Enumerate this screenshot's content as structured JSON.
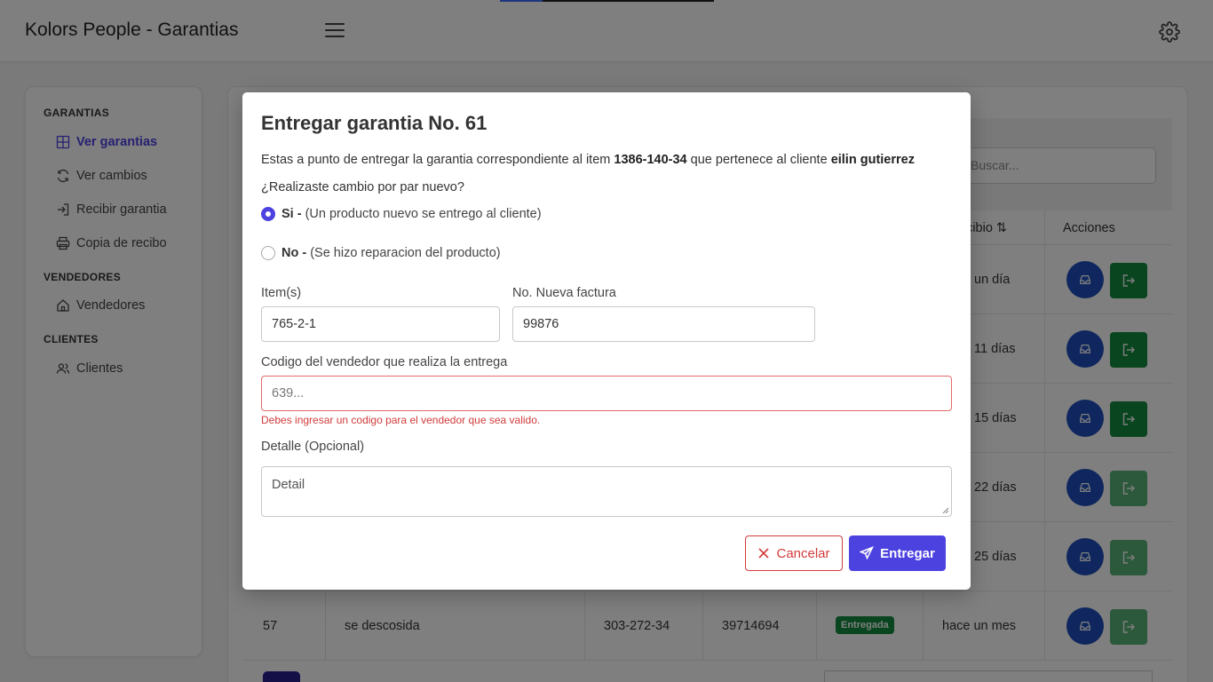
{
  "app": {
    "title": "Kolors People - Garantias"
  },
  "sidebar": {
    "sections": [
      {
        "title": "GARANTIAS",
        "items": [
          {
            "label": "Ver garantias",
            "icon": "grid-icon",
            "active": true
          },
          {
            "label": "Ver cambios",
            "icon": "refresh-icon"
          },
          {
            "label": "Recibir garantia",
            "icon": "sign-in-icon"
          },
          {
            "label": "Copia de recibo",
            "icon": "printer-icon"
          }
        ]
      },
      {
        "title": "VENDEDORES",
        "items": [
          {
            "label": "Vendedores",
            "icon": "home-icon"
          }
        ]
      },
      {
        "title": "CLIENTES",
        "items": [
          {
            "label": "Clientes",
            "icon": "users-icon"
          }
        ]
      }
    ]
  },
  "table": {
    "search_placeholder": "Buscar...",
    "header_recibio": "ecibio",
    "header_acciones": "Acciones",
    "recibio_values": [
      "un día",
      "11 días",
      "15 días",
      "22 días",
      "25 días"
    ],
    "last_row": {
      "id": "57",
      "detail": "se descosida",
      "item": "303-272-34",
      "invoice": "39714694",
      "status": "Entregada",
      "received": "hace un mes"
    }
  },
  "modal": {
    "title": "Entregar garantia No. 61",
    "desc_prefix": "Estas a punto de entregar la garantia correspondiente al item",
    "desc_item": "1386-140-34",
    "desc_middle": "que pertenece al cliente",
    "desc_client": "eilin gutierrez",
    "question": "¿Realizaste cambio por par nuevo?",
    "option_yes_bold": "Si -",
    "option_yes_text": "(Un producto nuevo se entrego al cliente)",
    "option_no_bold": "No -",
    "option_no_text": "(Se hizo reparacion del producto)",
    "items_label": "Item(s)",
    "items_value": "765-2-1",
    "invoice_label": "No. Nueva factura",
    "invoice_value": "99876",
    "seller_label": "Codigo del vendedor que realiza la entrega",
    "seller_placeholder": "639...",
    "seller_error": "Debes ingresar un codigo para el vendedor que sea valido.",
    "detail_label": "Detalle (Opcional)",
    "detail_placeholder": "Detail",
    "cancel_label": "Cancelar",
    "submit_label": "Entregar"
  },
  "colors": {
    "accent": "#4c42e0",
    "danger": "#d23b3b",
    "success": "#128a3c",
    "action_blue": "#1e4fbd"
  }
}
